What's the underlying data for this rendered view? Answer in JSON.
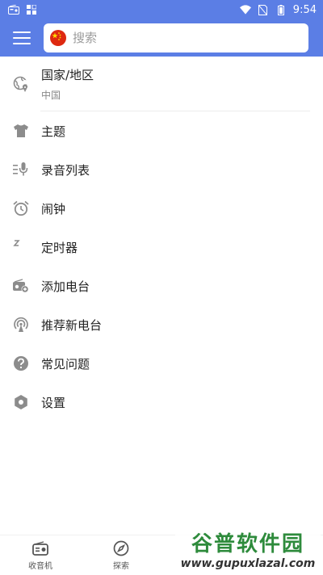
{
  "statusbar": {
    "time": "9:54"
  },
  "search": {
    "placeholder": "搜索"
  },
  "menu": {
    "region": {
      "label": "国家/地区",
      "value": "中国"
    },
    "items": [
      {
        "label": "主题",
        "icon": "tshirt-icon"
      },
      {
        "label": "录音列表",
        "icon": "recording-list-icon"
      },
      {
        "label": "闹钟",
        "icon": "alarm-icon"
      },
      {
        "label": "定时器",
        "icon": "sleep-timer-icon"
      },
      {
        "label": "添加电台",
        "icon": "add-radio-icon"
      },
      {
        "label": "推荐新电台",
        "icon": "broadcast-icon"
      },
      {
        "label": "常见问题",
        "icon": "help-icon"
      },
      {
        "label": "设置",
        "icon": "settings-icon"
      }
    ]
  },
  "bottomnav": {
    "tabs": [
      {
        "label": "收音机",
        "icon": "radio-icon"
      },
      {
        "label": "探索",
        "icon": "compass-icon"
      }
    ]
  },
  "watermark": {
    "title": "谷普软件园",
    "url": "www.gupuxlazal.com"
  },
  "colors": {
    "primary": "#5b7ee5",
    "icon_grey": "#8c8c8c"
  }
}
